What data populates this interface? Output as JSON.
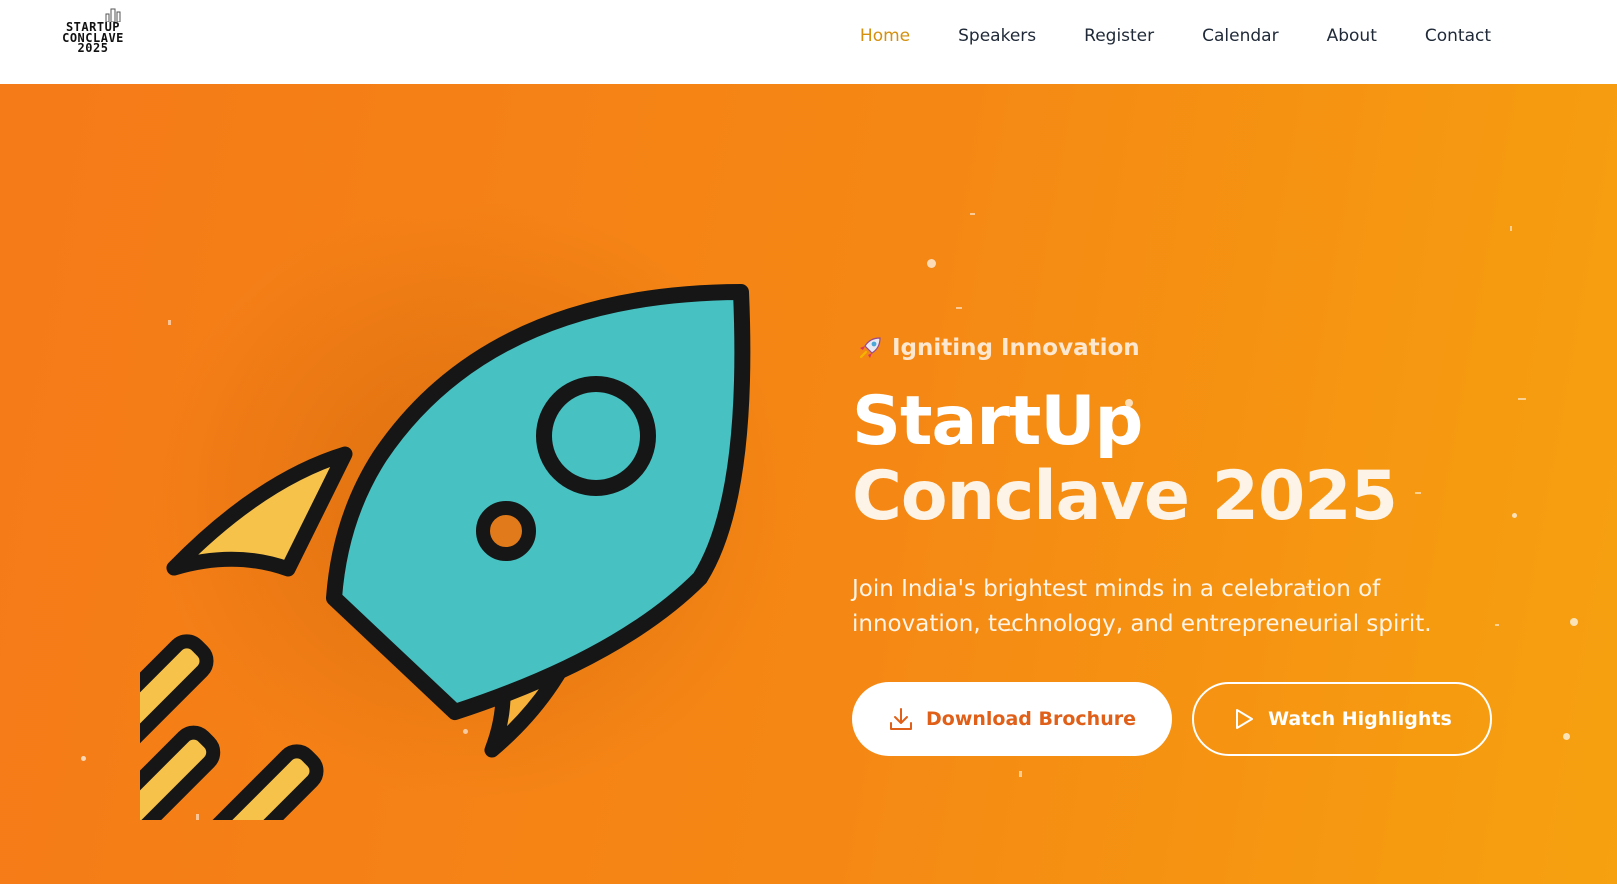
{
  "brand": {
    "logo_lines": [
      "STARTUP",
      "CONCLAVE",
      "2025"
    ]
  },
  "nav": {
    "items": [
      {
        "label": "Home",
        "active": true
      },
      {
        "label": "Speakers",
        "active": false
      },
      {
        "label": "Register",
        "active": false
      },
      {
        "label": "Calendar",
        "active": false
      },
      {
        "label": "About",
        "active": false
      },
      {
        "label": "Contact",
        "active": false
      }
    ],
    "active_color": "#d4900e"
  },
  "hero": {
    "tagline_icon": "rocket-icon",
    "tagline": "Igniting Innovation",
    "title_line1": "StartUp",
    "title_line2": "Conclave 2025",
    "subtitle": "Join India's brightest minds in a celebration of innovation, technology, and entrepreneurial spirit.",
    "primary_button": {
      "label": "Download Brochure",
      "icon": "download-icon"
    },
    "secondary_button": {
      "label": "Watch Highlights",
      "icon": "play-icon"
    },
    "background_colors": [
      "#f57a18",
      "#f6a10f"
    ],
    "illustration": "rocket-illustration"
  }
}
